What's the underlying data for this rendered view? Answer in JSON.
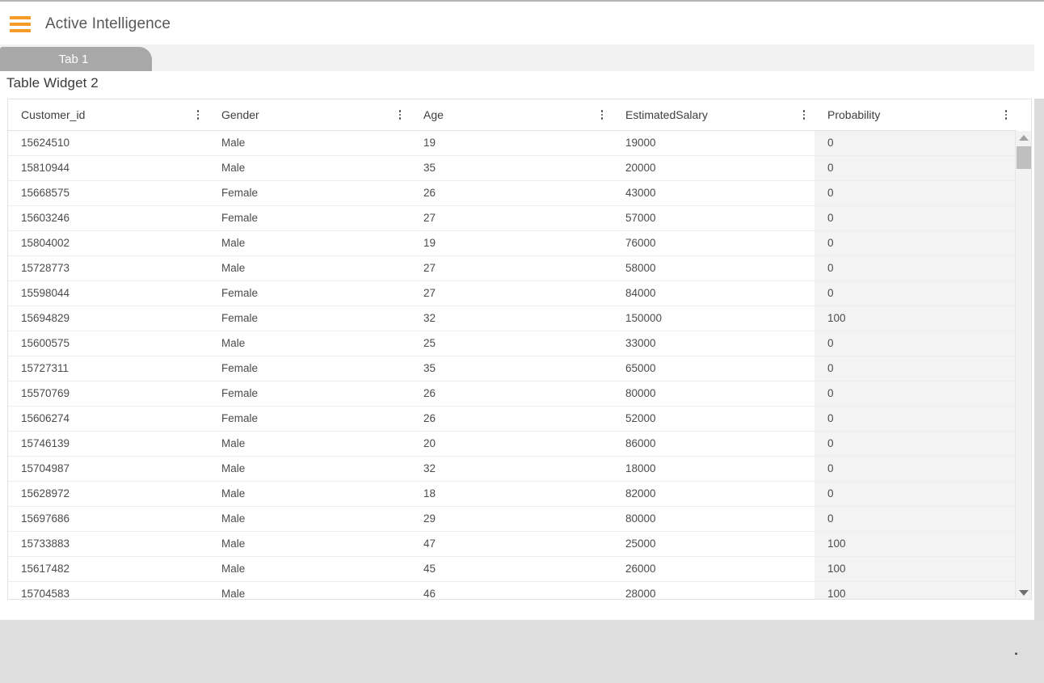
{
  "app": {
    "title": "Active Intelligence",
    "menu_icon": "hamburger-icon",
    "accent_color": "#f79c2a"
  },
  "tabs": [
    {
      "label": "Tab 1",
      "active": true
    }
  ],
  "widget": {
    "title": "Table Widget 2",
    "menu_icon": "kebab-menu-icon"
  },
  "table": {
    "columns": [
      {
        "key": "customer_id",
        "label": "Customer_id",
        "highlight": false
      },
      {
        "key": "gender",
        "label": "Gender",
        "highlight": false
      },
      {
        "key": "age",
        "label": "Age",
        "highlight": false
      },
      {
        "key": "estimated_salary",
        "label": "EstimatedSalary",
        "highlight": false
      },
      {
        "key": "probability",
        "label": "Probability",
        "highlight": true
      }
    ],
    "highlight_color": "#f3f3f3",
    "rows": [
      {
        "customer_id": "15624510",
        "gender": "Male",
        "age": "19",
        "estimated_salary": "19000",
        "probability": "0"
      },
      {
        "customer_id": "15810944",
        "gender": "Male",
        "age": "35",
        "estimated_salary": "20000",
        "probability": "0"
      },
      {
        "customer_id": "15668575",
        "gender": "Female",
        "age": "26",
        "estimated_salary": "43000",
        "probability": "0"
      },
      {
        "customer_id": "15603246",
        "gender": "Female",
        "age": "27",
        "estimated_salary": "57000",
        "probability": "0"
      },
      {
        "customer_id": "15804002",
        "gender": "Male",
        "age": "19",
        "estimated_salary": "76000",
        "probability": "0"
      },
      {
        "customer_id": "15728773",
        "gender": "Male",
        "age": "27",
        "estimated_salary": "58000",
        "probability": "0"
      },
      {
        "customer_id": "15598044",
        "gender": "Female",
        "age": "27",
        "estimated_salary": "84000",
        "probability": "0"
      },
      {
        "customer_id": "15694829",
        "gender": "Female",
        "age": "32",
        "estimated_salary": "150000",
        "probability": "100"
      },
      {
        "customer_id": "15600575",
        "gender": "Male",
        "age": "25",
        "estimated_salary": "33000",
        "probability": "0"
      },
      {
        "customer_id": "15727311",
        "gender": "Female",
        "age": "35",
        "estimated_salary": "65000",
        "probability": "0"
      },
      {
        "customer_id": "15570769",
        "gender": "Female",
        "age": "26",
        "estimated_salary": "80000",
        "probability": "0"
      },
      {
        "customer_id": "15606274",
        "gender": "Female",
        "age": "26",
        "estimated_salary": "52000",
        "probability": "0"
      },
      {
        "customer_id": "15746139",
        "gender": "Male",
        "age": "20",
        "estimated_salary": "86000",
        "probability": "0"
      },
      {
        "customer_id": "15704987",
        "gender": "Male",
        "age": "32",
        "estimated_salary": "18000",
        "probability": "0"
      },
      {
        "customer_id": "15628972",
        "gender": "Male",
        "age": "18",
        "estimated_salary": "82000",
        "probability": "0"
      },
      {
        "customer_id": "15697686",
        "gender": "Male",
        "age": "29",
        "estimated_salary": "80000",
        "probability": "0"
      },
      {
        "customer_id": "15733883",
        "gender": "Male",
        "age": "47",
        "estimated_salary": "25000",
        "probability": "100"
      },
      {
        "customer_id": "15617482",
        "gender": "Male",
        "age": "45",
        "estimated_salary": "26000",
        "probability": "100"
      },
      {
        "customer_id": "15704583",
        "gender": "Male",
        "age": "46",
        "estimated_salary": "28000",
        "probability": "100"
      }
    ]
  },
  "scrollbars": {
    "vertical": {
      "up_icon": "triangle-up-icon",
      "down_icon": "triangle-down-icon"
    },
    "horizontal": {
      "left_icon": "triangle-left-icon",
      "right_icon": "triangle-right-icon"
    }
  }
}
